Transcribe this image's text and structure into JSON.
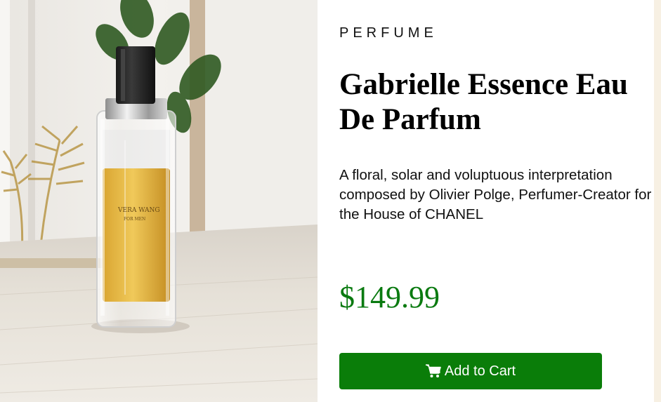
{
  "product": {
    "category": "PERFUME",
    "name": "Gabrielle Essence Eau De Parfum",
    "description": "A floral, solar and voluptuous interpretation composed by Olivier Polge, Perfumer-Creator for the House of CHANEL",
    "price": "$149.99",
    "image_label_line1": "VERA WANG",
    "image_label_line2": "FOR MEN"
  },
  "actions": {
    "add_to_cart_label": "Add to Cart",
    "add_to_cart_icon": "shopping-cart-icon"
  },
  "colors": {
    "price": "#0a7a10",
    "button": "#0a7d09",
    "page_background": "#f7f0e3"
  }
}
